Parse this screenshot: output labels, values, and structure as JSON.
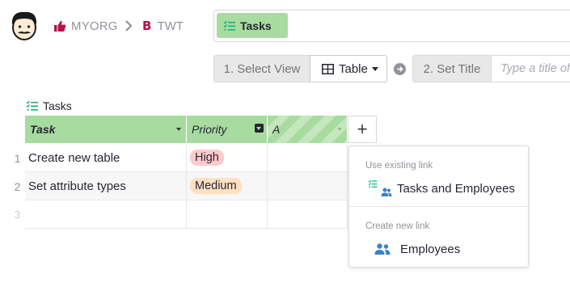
{
  "breadcrumb": {
    "org": "MYORG",
    "doc": "TWT"
  },
  "page": {
    "name": "Tasks"
  },
  "steps": {
    "step1_label": "1. Select View",
    "view_label": "Table",
    "step2_label": "2. Set Title",
    "title_placeholder": "Type a title of"
  },
  "section": {
    "title": "Tasks"
  },
  "grid": {
    "columns": [
      "Task",
      "Priority",
      "A"
    ],
    "add_column_label": "+",
    "rows": [
      {
        "num": "1",
        "task": "Create new table",
        "priority": "High"
      },
      {
        "num": "2",
        "task": "Set attribute types",
        "priority": "Medium"
      },
      {
        "num": "3",
        "task": "",
        "priority": ""
      }
    ]
  },
  "link_menu": {
    "existing_header": "Use existing link",
    "existing_item": "Tasks and Employees",
    "new_header": "Create new link",
    "new_item": "Employees"
  },
  "colors": {
    "accent_green": "#a8dba0",
    "icon_green": "#16b378",
    "brand_pink": "#b5124a",
    "chip_high_bg": "#fecbcc",
    "chip_medium_bg": "#fee0c1",
    "people_blue": "#3b82c4"
  },
  "icons": {
    "avatar": "mustache-avatar",
    "org": "thumbs-up-icon",
    "doc": "letter-b-icon",
    "page": "list-icon",
    "table": "table-icon",
    "next": "arrow-right-circle-icon",
    "people": "people-icon"
  }
}
